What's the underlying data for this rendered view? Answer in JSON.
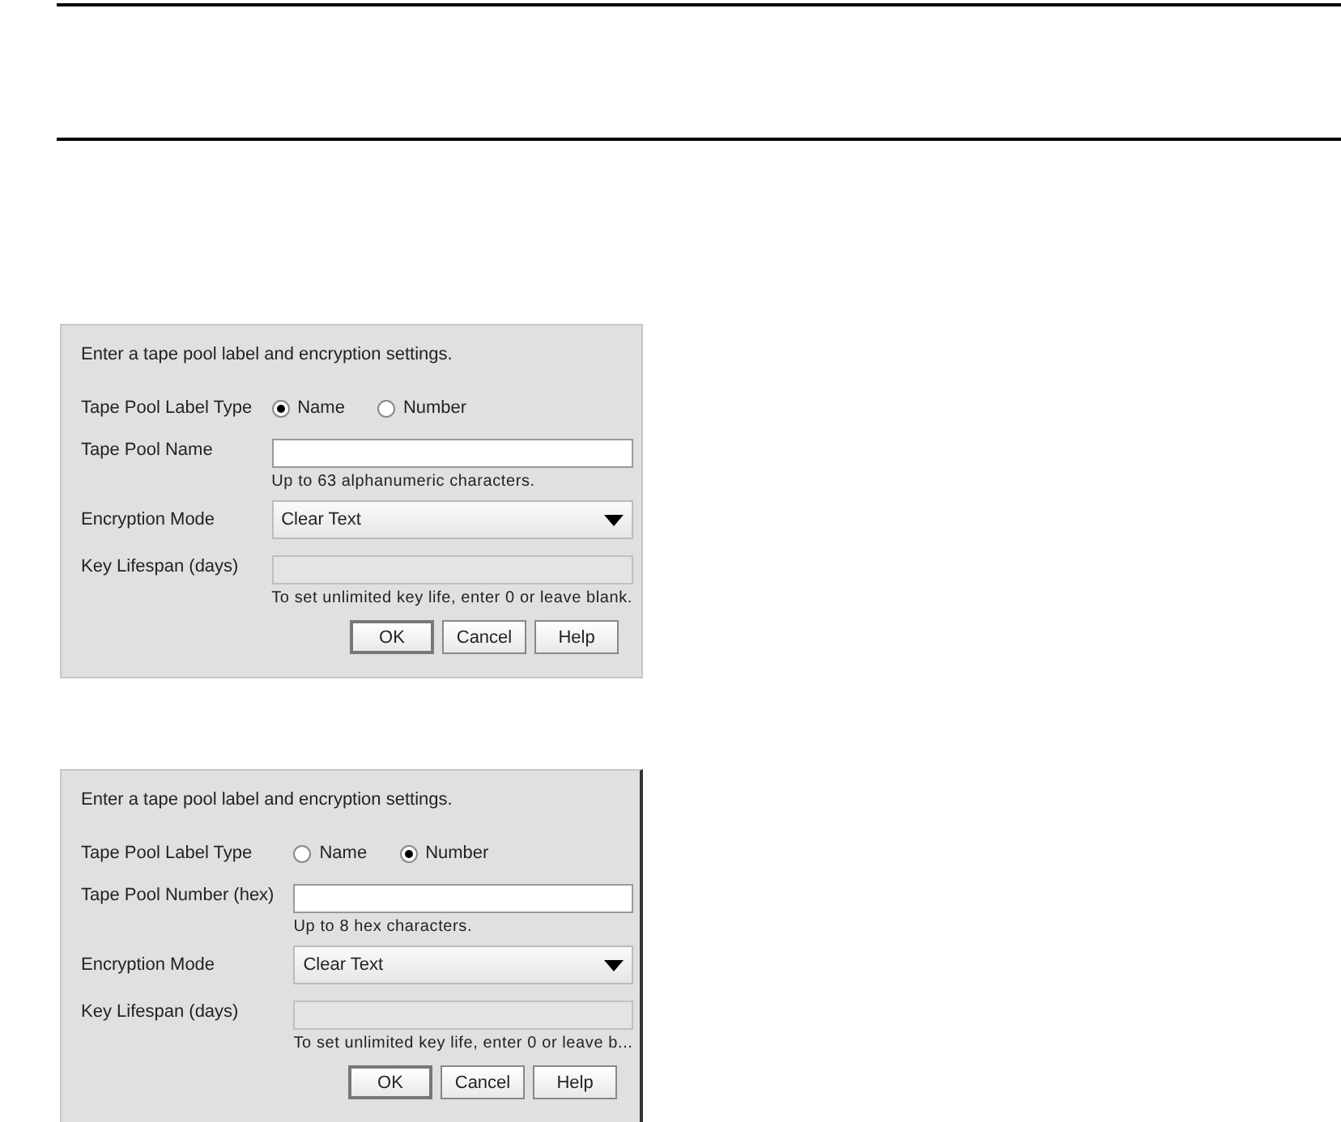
{
  "panels": [
    {
      "intro": "Enter a tape pool label and encryption settings.",
      "label_type": {
        "label": "Tape Pool Label Type",
        "options": [
          {
            "label": "Name",
            "selected": true
          },
          {
            "label": "Number",
            "selected": false
          }
        ]
      },
      "pool_field": {
        "label": "Tape Pool Name",
        "hint": "Up to 63 alphanumeric characters."
      },
      "encryption": {
        "label": "Encryption Mode",
        "value": "Clear Text"
      },
      "lifespan": {
        "label": "Key Lifespan (days)",
        "disabled": true,
        "hint": "To set unlimited key life, enter 0 or leave blank."
      },
      "buttons": [
        "OK",
        "Cancel",
        "Help"
      ]
    },
    {
      "intro": "Enter a tape pool label and encryption settings.",
      "label_type": {
        "label": "Tape Pool Label Type",
        "options": [
          {
            "label": "Name",
            "selected": false
          },
          {
            "label": "Number",
            "selected": true
          }
        ]
      },
      "pool_field": {
        "label": "Tape Pool Number (hex)",
        "hint": "Up to 8 hex characters."
      },
      "encryption": {
        "label": "Encryption Mode",
        "value": "Clear Text"
      },
      "lifespan": {
        "label": "Key Lifespan (days)",
        "disabled": true,
        "hint": "To set unlimited key life, enter 0 or leave b..."
      },
      "buttons": [
        "OK",
        "Cancel",
        "Help"
      ]
    }
  ]
}
